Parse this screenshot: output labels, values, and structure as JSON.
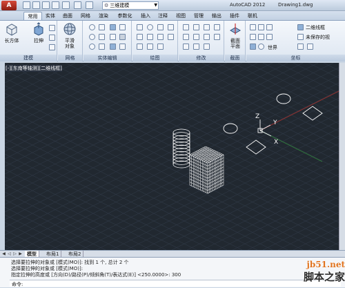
{
  "titlebar": {
    "app_button": "A",
    "workspace": "三维建模",
    "app_name": "AutoCAD 2012",
    "file_name": "Drawing1.dwg"
  },
  "tabs": [
    "常用",
    "实体",
    "曲面",
    "网格",
    "渲染",
    "参数化",
    "插入",
    "注释",
    "视图",
    "管理",
    "输出",
    "插件",
    "联机"
  ],
  "ribbon": {
    "panels": [
      "建模",
      "网格",
      "实体编辑",
      "绘图",
      "修改",
      "截面",
      "坐标"
    ],
    "big_buttons": {
      "box": "长方体",
      "extrude": "拉伸",
      "smooth_1": "平滑",
      "smooth_2": "对象",
      "section_1": "截面",
      "section_2": "平面"
    },
    "view_items": [
      "二维线框",
      "未保存的视",
      "世界"
    ]
  },
  "viewport": {
    "label": "[-][东南等轴测][二维线框]",
    "ucs_x": "X",
    "ucs_y": "Y",
    "ucs_z": "Z"
  },
  "layout_tabs": [
    "模型",
    "布局1",
    "布局2"
  ],
  "command": {
    "lines": [
      "选择要拉伸的对象或 [模式(MO)]: 找到 1 个, 总计 2 个",
      "选择要拉伸的对象或 [模式(MO)]:",
      "指定拉伸的高度或 [方向(D)/路径(P)/倾斜角(T)/表达式(E)] <250.0000>: 300"
    ],
    "prompt": "命令:"
  },
  "watermark": {
    "site": "jb51.net",
    "name": "脚本之家"
  },
  "colors": {
    "viewport_bg": "#212830",
    "grid": "#2e3743",
    "wire": "#ffffff"
  }
}
